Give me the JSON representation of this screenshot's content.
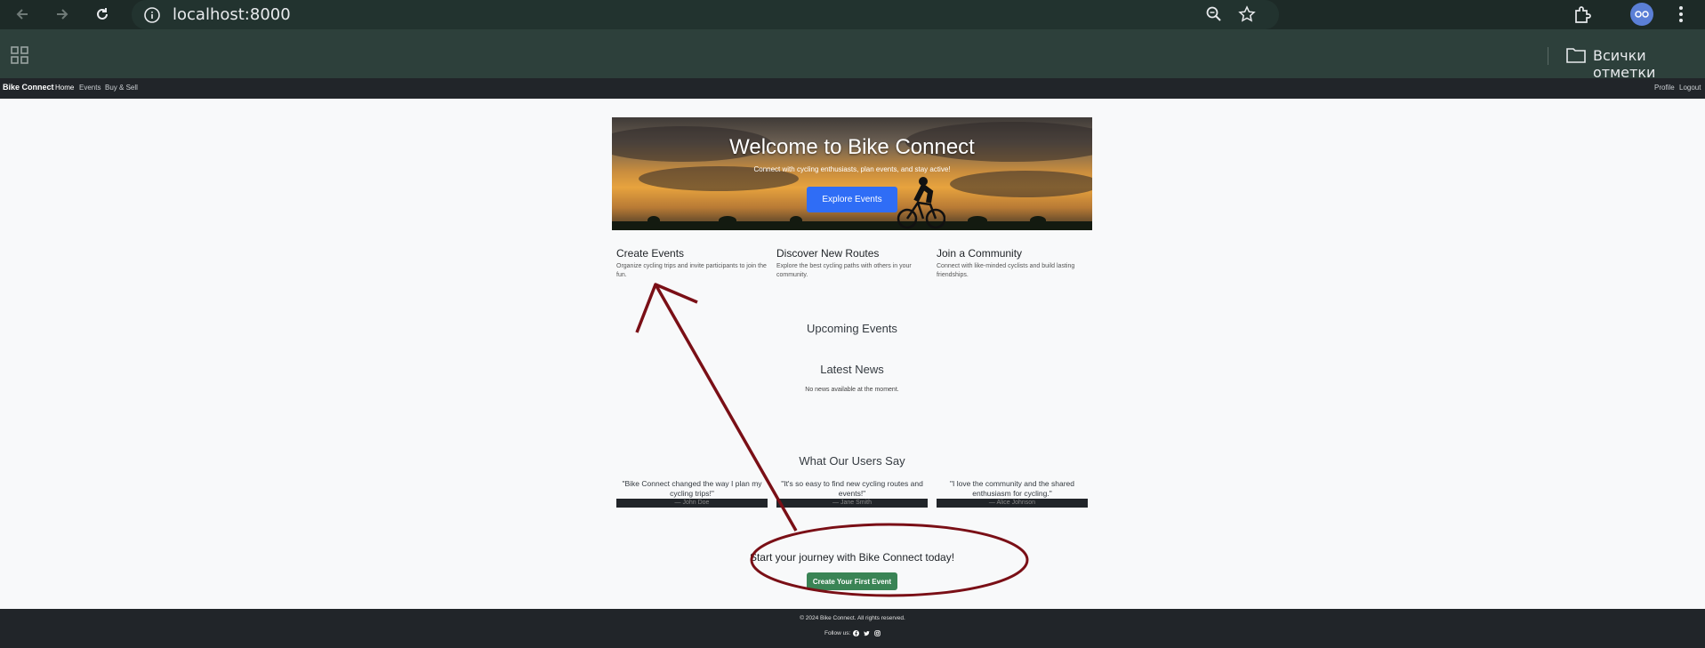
{
  "browser": {
    "url": "localhost:8000",
    "bookmarks_label": "Всички отметки",
    "icons": [
      "back-arrow-icon",
      "forward-arrow-icon",
      "reload-icon",
      "site-info-icon",
      "zoom-icon",
      "star-icon",
      "extensions-icon",
      "profile-avatar-icon",
      "more-menu-icon",
      "apps-grid-icon",
      "folder-icon"
    ]
  },
  "navbar": {
    "brand": "Bike Connect",
    "links": [
      "Home",
      "Events",
      "Buy & Sell"
    ],
    "right_links": [
      "Profile",
      "Logout"
    ]
  },
  "hero": {
    "title": "Welcome to Bike Connect",
    "subtitle": "Connect with cycling enthusiasts, plan events, and stay active!",
    "button": "Explore Events"
  },
  "features": [
    {
      "title": "Create Events",
      "text": "Organize cycling trips and invite participants to join the fun."
    },
    {
      "title": "Discover New Routes",
      "text": "Explore the best cycling paths with others in your community."
    },
    {
      "title": "Join a Community",
      "text": "Connect with like-minded cyclists and build lasting friendships."
    }
  ],
  "upcoming": {
    "title": "Upcoming Events"
  },
  "news": {
    "title": "Latest News",
    "empty": "No news available at the moment."
  },
  "testimonials": {
    "title": "What Our Users Say",
    "items": [
      {
        "quote": "\"Bike Connect changed the way I plan my cycling trips!\"",
        "author": "— John Doe"
      },
      {
        "quote": "\"It's so easy to find new cycling routes and events!\"",
        "author": "— Jane Smith"
      },
      {
        "quote": "\"I love the community and the shared enthusiasm for cycling.\"",
        "author": "— Alice Johnson"
      }
    ]
  },
  "cta": {
    "text": "Start your journey with Bike Connect today!",
    "button": "Create Your First Event"
  },
  "footer": {
    "copyright": "© 2024 Bike Connect. All rights reserved.",
    "follow": "Follow us:",
    "social_icons": [
      "facebook-icon",
      "twitter-icon",
      "instagram-icon"
    ]
  },
  "colors": {
    "annotation": "#7a0f16",
    "primary": "#2f6df6",
    "success": "#3a8455",
    "dark": "#212529"
  }
}
